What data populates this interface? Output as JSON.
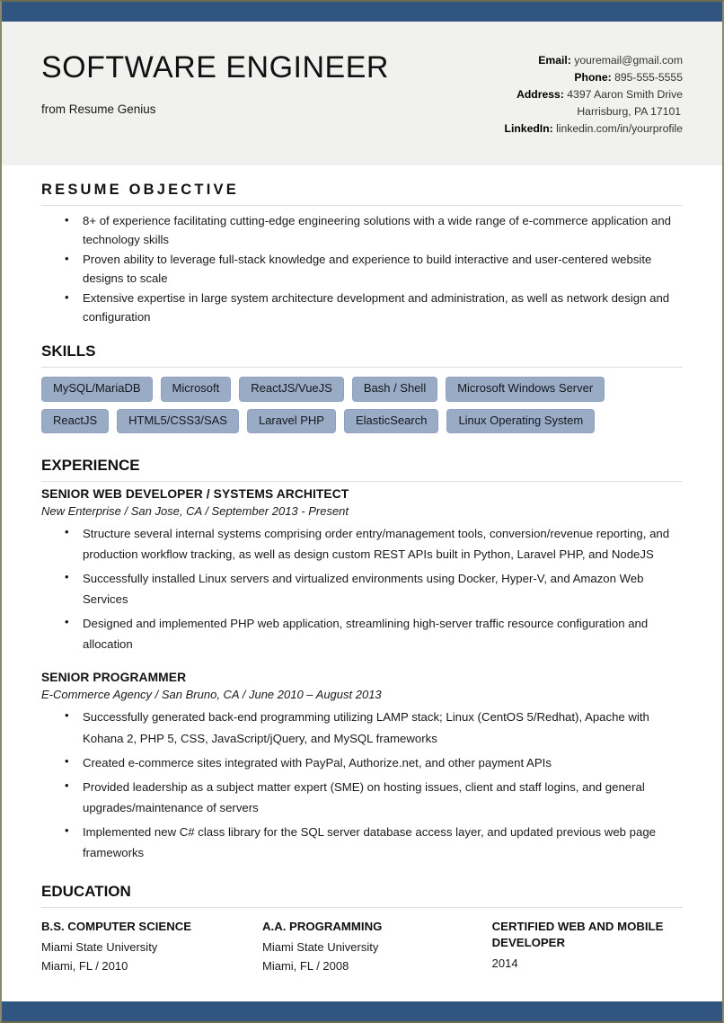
{
  "theme": {
    "bar_color": "#2f5580",
    "header_bg": "#f1f1ef",
    "chip_bg": "#9aabc5",
    "rule_color": "#dedede",
    "page_border": "#8a8a6a"
  },
  "header": {
    "job_title": "SOFTWARE ENGINEER",
    "from_line": "from Resume Genius",
    "contact": {
      "email_label": "Email:",
      "email_value": "youremail@gmail.com",
      "phone_label": "Phone:",
      "phone_value": "895-555-5555",
      "address_label": "Address:",
      "address_value_line1": "4397 Aaron Smith Drive",
      "address_value_line2": "Harrisburg, PA 17101",
      "linkedin_label": "LinkedIn:",
      "linkedin_value": "linkedin.com/in/yourprofile"
    }
  },
  "objective": {
    "heading": "RESUME OBJECTIVE",
    "bullets": [
      "8+ of experience facilitating cutting-edge engineering solutions with a wide range of e-commerce application and technology skills",
      "Proven ability to leverage full-stack knowledge and experience to build interactive and user-centered website designs to scale",
      "Extensive expertise in large system architecture development and administration, as well as network design and configuration"
    ]
  },
  "skills": {
    "heading": "SKILLS",
    "rows": [
      [
        "MySQL/MariaDB",
        "Microsoft",
        "ReactJS/VueJS",
        "Bash / Shell",
        "Microsoft Windows Server"
      ],
      [
        "ReactJS",
        "HTML5/CSS3/SAS",
        "Laravel PHP",
        "ElasticSearch",
        "Linux Operating System"
      ]
    ]
  },
  "experience": {
    "heading": "EXPERIENCE",
    "jobs": [
      {
        "title": "SENIOR WEB DEVELOPER / SYSTEMS ARCHITECT",
        "meta": "New Enterprise / San Jose, CA / September 2013 - Present",
        "bullets": [
          "Structure several internal systems comprising order entry/management tools, conversion/revenue reporting, and production workflow tracking, as well as design custom REST APIs built in Python, Laravel PHP, and NodeJS",
          "Successfully installed Linux servers and virtualized environments using Docker, Hyper-V, and Amazon Web Services",
          "Designed and implemented PHP web application, streamlining high-server traffic resource configuration and allocation"
        ]
      },
      {
        "title": "SENIOR PROGRAMMER",
        "meta": "E-Commerce Agency / San Bruno, CA / June 2010 – August 2013",
        "bullets": [
          "Successfully generated back-end programming utilizing LAMP stack; Linux (CentOS 5/Redhat), Apache with Kohana 2, PHP 5, CSS, JavaScript/jQuery, and MySQL frameworks",
          "Created e-commerce sites integrated with PayPal, Authorize.net, and other payment APIs",
          "Provided leadership as a subject matter expert (SME) on hosting issues, client and staff logins, and general upgrades/maintenance of servers",
          "Implemented new C# class library for the SQL server database access layer, and updated previous web page frameworks"
        ]
      }
    ]
  },
  "education": {
    "heading": "EDUCATION",
    "entries": [
      {
        "degree": "B.S. COMPUTER SCIENCE",
        "school": "Miami State University",
        "location_year": "Miami, FL / 2010"
      },
      {
        "degree": "A.A. PROGRAMMING",
        "school": "Miami State University",
        "location_year": "Miami, FL / 2008"
      },
      {
        "degree": "CERTIFIED WEB AND MOBILE DEVELOPER",
        "school": "2014",
        "location_year": ""
      }
    ]
  }
}
